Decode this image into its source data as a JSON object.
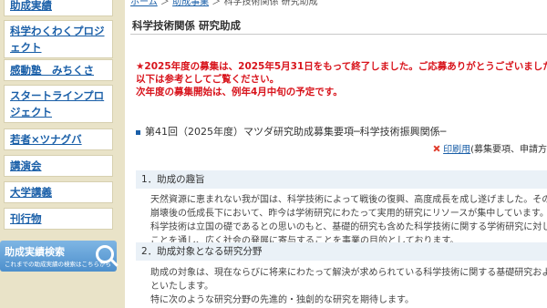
{
  "sidebar": {
    "items": [
      {
        "label": "助成実績"
      },
      {
        "label": "科学わくわくプロジェクト"
      },
      {
        "label": "感動塾　みちくさ"
      },
      {
        "label": "スタートラインプロジェクト"
      },
      {
        "label": "若者×ツナグバ"
      },
      {
        "label": "講演会"
      },
      {
        "label": "大学講義"
      },
      {
        "label": "刊行物"
      }
    ],
    "search_banner": {
      "title": "助成実績検索",
      "subtitle": "これまでの助成実績の検索はこちらから"
    }
  },
  "breadcrumb": {
    "link1": "ホーム",
    "link2": "助成事業",
    "current": "科学技術関係 研究助成"
  },
  "page_title": "科学技術関係 研究助成",
  "notice": {
    "line1": "★2025年度の募集は、2025年5月31日をもって終了しました。ご応募ありがとうございました。",
    "line2": "以下は参考としてご覧ください。",
    "line3": "次年度の募集開始は、例年4月中旬の予定です。"
  },
  "section": {
    "title": "第41回（2025年度）マツダ研究助成募集要項─科学技術振興関係─",
    "print_link": "印刷用",
    "print_suffix": "(募集要項、申請方"
  },
  "subsections": [
    {
      "heading": "1．助成の趣旨",
      "lines": [
        "天然資源に恵まれない我が国は、科学技術によって戦後の復興、高度成長を成し遂げました。その後のバ",
        "崩壊後の低成長下において、昨今は学術研究にわたって実用的研究にリソースが集中しています。本財団は",
        "科学技術は立国の礎であるとの思いのもと、基礎的研究も含めた科学技術に関する学術研究に対して助成",
        "ことを通し、広く社会の発展に寄与することを事業の目的としております。"
      ]
    },
    {
      "heading": "2．助成対象となる研究分野",
      "lines": [
        "助成の対象は、現在ならびに将来にわたって解決が求められている科学技術に関する基礎研究および応用",
        "といたします。",
        "特に次のような研究分野の先進的・独創的な研究を期待します。"
      ]
    }
  ]
}
